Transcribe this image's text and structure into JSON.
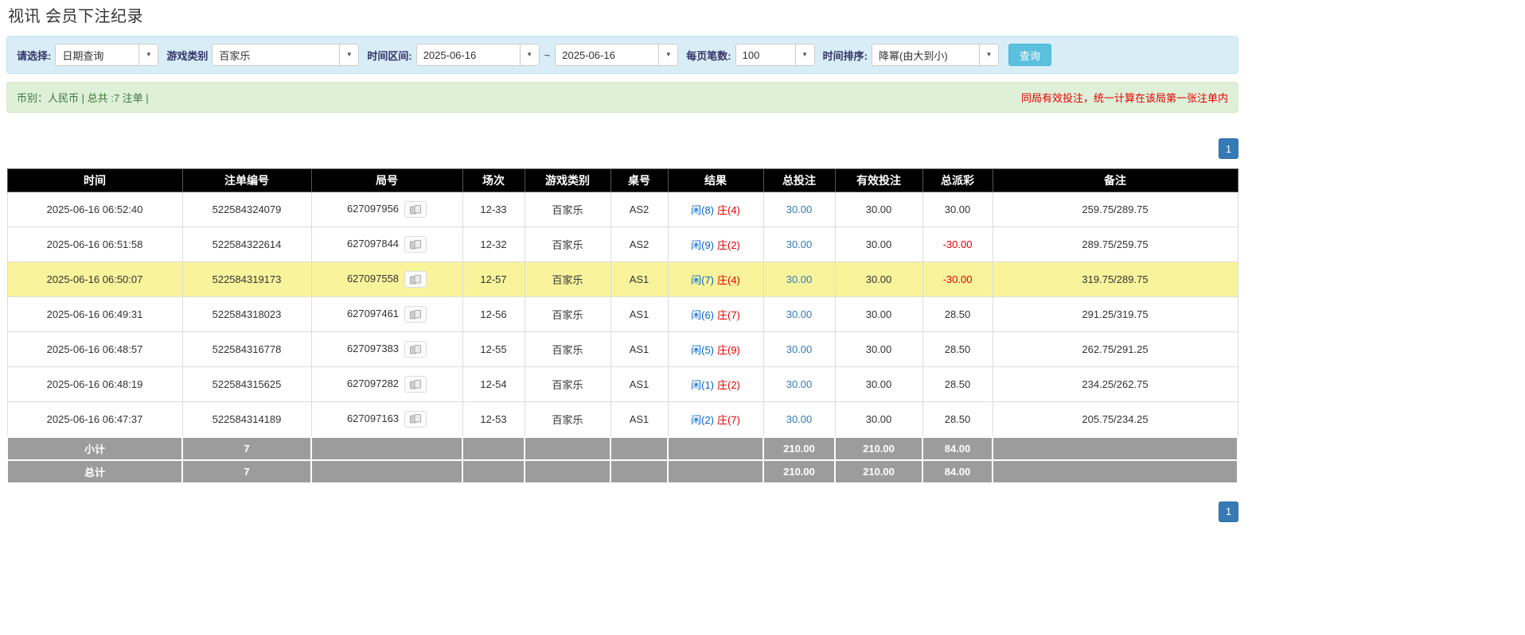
{
  "title": "视讯 会员下注纪录",
  "colors": {
    "filter_bar_bg": "#d9edf7",
    "info_bar_bg": "#dff0d8",
    "table_header_bg": "#000000",
    "highlight_row_bg": "#f9f49c",
    "footer_row_bg": "#9c9c9c",
    "pagination_blue": "#337ab7",
    "search_button_bg": "#5bc0de",
    "player_blue": "#0066cc",
    "banker_red": "#e60000",
    "negative_red": "#e60000",
    "notice_red": "#e60000"
  },
  "filters": {
    "select_label": "请选择:",
    "select_value": "日期查询",
    "game_label": "游戏类别",
    "game_value": "百家乐",
    "range_label": "时间区间:",
    "date_from": "2025-06-16",
    "range_separator": "~",
    "date_to": "2025-06-16",
    "page_size_label": "每页笔数:",
    "page_size_value": "100",
    "sort_label": "时间排序:",
    "sort_value": "降幂(由大到小)",
    "search_label": "查询"
  },
  "info_bar": {
    "summary": "币别：人民币 | 总共 :7 注单 |",
    "notice": "同局有效投注，统一计算在该局第一张注单内"
  },
  "pagination": {
    "current_page": "1"
  },
  "table": {
    "headers": [
      "时间",
      "注单编号",
      "局号",
      "场次",
      "游戏类别",
      "桌号",
      "结果",
      "总投注",
      "有效投注",
      "总派彩",
      "备注"
    ],
    "rows": [
      {
        "time": "2025-06-16 06:52:40",
        "bet_id": "522584324079",
        "round": "627097956",
        "session": "12-33",
        "game": "百家乐",
        "table_no": "AS2",
        "player": "闲(8)",
        "banker": "庄(4)",
        "total_bet": "30.00",
        "valid_bet": "30.00",
        "payout": "30.00",
        "remark": "259.75/289.75",
        "highlight": false
      },
      {
        "time": "2025-06-16 06:51:58",
        "bet_id": "522584322614",
        "round": "627097844",
        "session": "12-32",
        "game": "百家乐",
        "table_no": "AS2",
        "player": "闲(9)",
        "banker": "庄(2)",
        "total_bet": "30.00",
        "valid_bet": "30.00",
        "payout": "-30.00",
        "remark": "289.75/259.75",
        "highlight": false
      },
      {
        "time": "2025-06-16 06:50:07",
        "bet_id": "522584319173",
        "round": "627097558",
        "session": "12-57",
        "game": "百家乐",
        "table_no": "AS1",
        "player": "闲(7)",
        "banker": "庄(4)",
        "total_bet": "30.00",
        "valid_bet": "30.00",
        "payout": "-30.00",
        "remark": "319.75/289.75",
        "highlight": true
      },
      {
        "time": "2025-06-16 06:49:31",
        "bet_id": "522584318023",
        "round": "627097461",
        "session": "12-56",
        "game": "百家乐",
        "table_no": "AS1",
        "player": "闲(6)",
        "banker": "庄(7)",
        "total_bet": "30.00",
        "valid_bet": "30.00",
        "payout": "28.50",
        "remark": "291.25/319.75",
        "highlight": false
      },
      {
        "time": "2025-06-16 06:48:57",
        "bet_id": "522584316778",
        "round": "627097383",
        "session": "12-55",
        "game": "百家乐",
        "table_no": "AS1",
        "player": "闲(5)",
        "banker": "庄(9)",
        "total_bet": "30.00",
        "valid_bet": "30.00",
        "payout": "28.50",
        "remark": "262.75/291.25",
        "highlight": false
      },
      {
        "time": "2025-06-16 06:48:19",
        "bet_id": "522584315625",
        "round": "627097282",
        "session": "12-54",
        "game": "百家乐",
        "table_no": "AS1",
        "player": "闲(1)",
        "banker": "庄(2)",
        "total_bet": "30.00",
        "valid_bet": "30.00",
        "payout": "28.50",
        "remark": "234.25/262.75",
        "highlight": false
      },
      {
        "time": "2025-06-16 06:47:37",
        "bet_id": "522584314189",
        "round": "627097163",
        "session": "12-53",
        "game": "百家乐",
        "table_no": "AS1",
        "player": "闲(2)",
        "banker": "庄(7)",
        "total_bet": "30.00",
        "valid_bet": "30.00",
        "payout": "28.50",
        "remark": "205.75/234.25",
        "highlight": false
      }
    ],
    "footer": [
      {
        "label": "小计",
        "count": "7",
        "total_bet": "210.00",
        "valid_bet": "210.00",
        "payout": "84.00"
      },
      {
        "label": "总计",
        "count": "7",
        "total_bet": "210.00",
        "valid_bet": "210.00",
        "payout": "84.00"
      }
    ]
  }
}
